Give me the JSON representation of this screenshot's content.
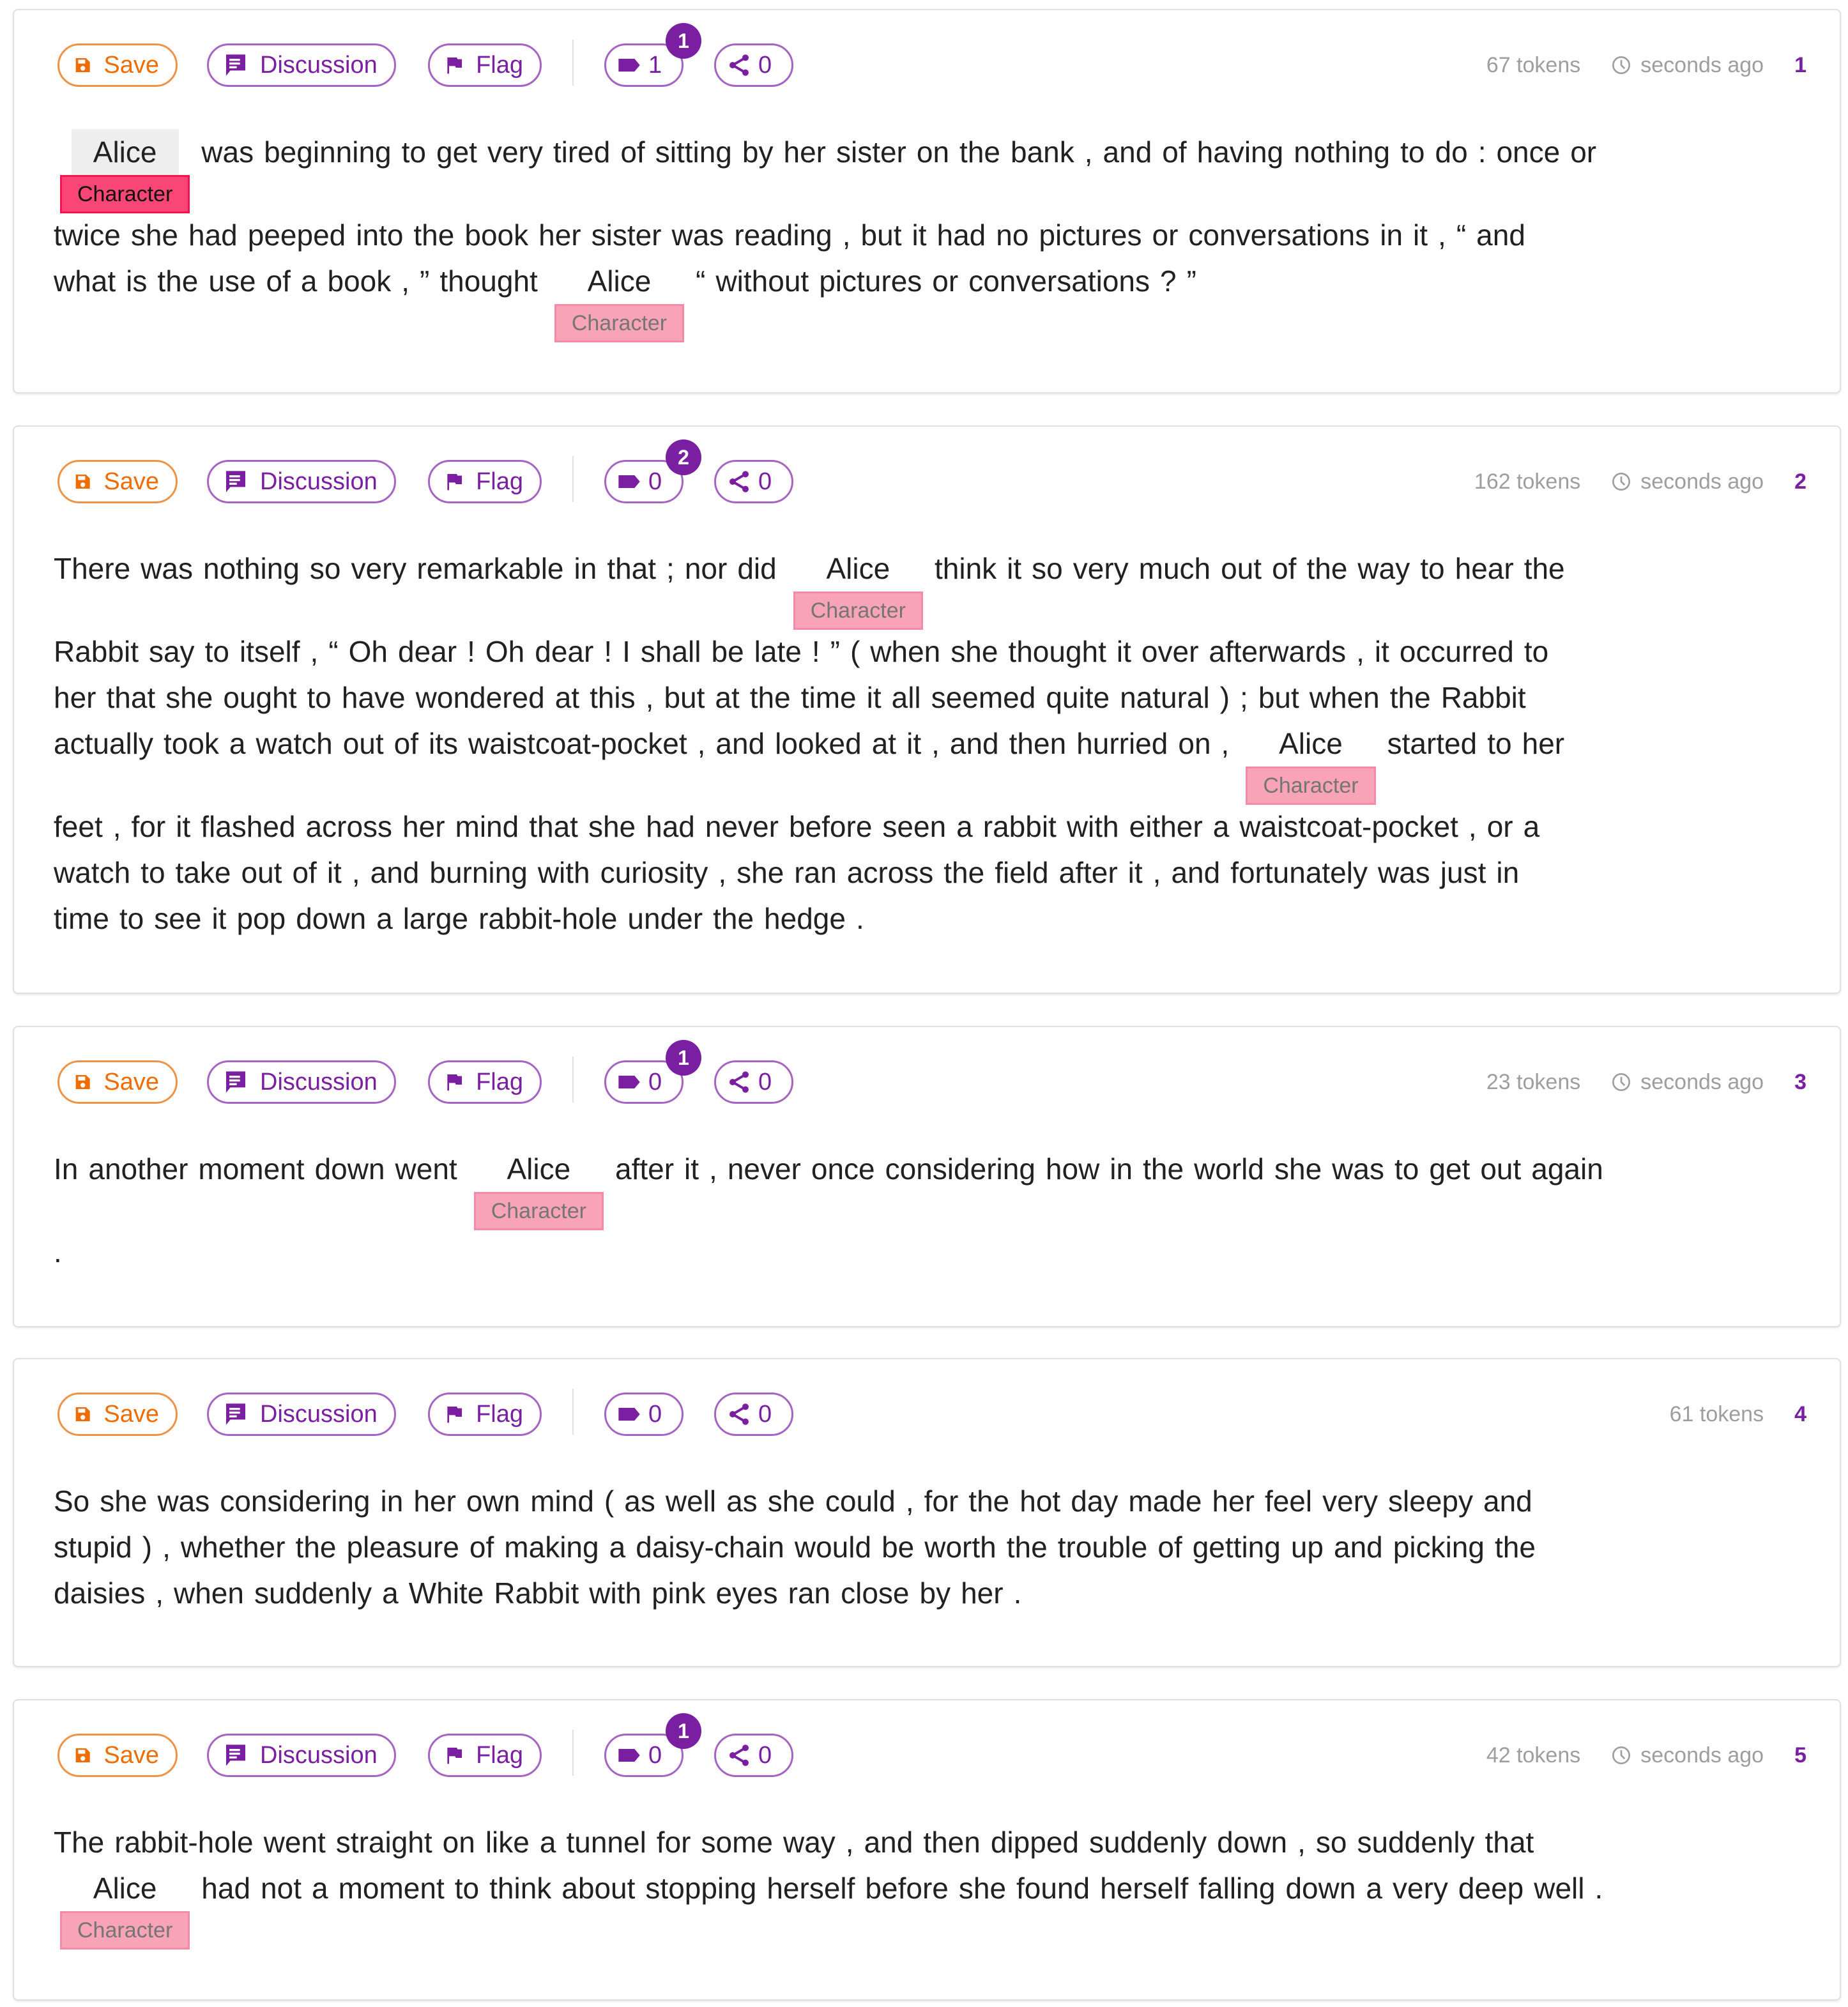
{
  "colors": {
    "accent": "#7b1fa2",
    "save": "#ef6c00",
    "label_bg": "#f9a3b9",
    "label_active_bg": "#f94677",
    "muted_text": "#9e9e9e"
  },
  "toolbar_labels": {
    "save": "Save",
    "discussion": "Discussion",
    "flag": "Flag"
  },
  "icons": {
    "save": "floppy-disk-icon",
    "discussion": "chat-bubble-icon",
    "flag": "flag-icon",
    "tag": "label-tag-icon",
    "share": "share-icon",
    "time": "clock-icon"
  },
  "cards": [
    {
      "index": "1",
      "tokens": "67 tokens",
      "time": "seconds ago",
      "tag_count": "1",
      "share_count": "0",
      "badge": "1",
      "lines": [
        [
          {
            "e": "Alice",
            "label": "Character",
            "active": true
          },
          "was",
          "beginning",
          "to",
          "get",
          "very",
          "tired",
          "of",
          "sitting",
          "by",
          "her",
          "sister",
          "on",
          "the",
          "bank",
          ",",
          "and",
          "of",
          "having",
          "nothing",
          "to",
          "do",
          ":",
          "once",
          "or"
        ],
        [
          "twice",
          "she",
          "had",
          "peeped",
          "into",
          "the",
          "book",
          "her",
          "sister",
          "was",
          "reading",
          ",",
          "but",
          "it",
          "had",
          "no",
          "pictures",
          "or",
          "conversations",
          "in",
          "it",
          ",",
          "“",
          "and"
        ],
        [
          "what",
          "is",
          "the",
          "use",
          "of",
          "a",
          "book",
          ",",
          "”",
          "thought",
          {
            "e": "Alice",
            "label": "Character"
          },
          "“",
          "without",
          "pictures",
          "or",
          "conversations",
          "?",
          "”"
        ]
      ]
    },
    {
      "index": "2",
      "tokens": "162 tokens",
      "time": "seconds ago",
      "tag_count": "0",
      "share_count": "0",
      "badge": "2",
      "lines": [
        [
          "There",
          "was",
          "nothing",
          "so",
          "very",
          "remarkable",
          "in",
          "that",
          ";",
          "nor",
          "did",
          {
            "e": "Alice",
            "label": "Character"
          },
          "think",
          "it",
          "so",
          "very",
          "much",
          "out",
          "of",
          "the",
          "way",
          "to",
          "hear",
          "the"
        ],
        [
          "Rabbit",
          "say",
          "to",
          "itself",
          ",",
          "“",
          "Oh",
          "dear",
          "!",
          "Oh",
          "dear",
          "!",
          "I",
          "shall",
          "be",
          "late",
          "!",
          "”",
          "(",
          "when",
          "she",
          "thought",
          "it",
          "over",
          "afterwards",
          ",",
          "it",
          "occurred",
          "to"
        ],
        [
          "her",
          "that",
          "she",
          "ought",
          "to",
          "have",
          "wondered",
          "at",
          "this",
          ",",
          "but",
          "at",
          "the",
          "time",
          "it",
          "all",
          "seemed",
          "quite",
          "natural",
          ")",
          ";",
          "but",
          "when",
          "the",
          "Rabbit"
        ],
        [
          "actually",
          "took",
          "a",
          "watch",
          "out",
          "of",
          "its",
          "waistcoat-pocket",
          ",",
          "and",
          "looked",
          "at",
          "it",
          ",",
          "and",
          "then",
          "hurried",
          "on",
          ",",
          {
            "e": "Alice",
            "label": "Character"
          },
          "started",
          "to",
          "her"
        ],
        [
          "feet",
          ",",
          "for",
          "it",
          "flashed",
          "across",
          "her",
          "mind",
          "that",
          "she",
          "had",
          "never",
          "before",
          "seen",
          "a",
          "rabbit",
          "with",
          "either",
          "a",
          "waistcoat-pocket",
          ",",
          "or",
          "a"
        ],
        [
          "watch",
          "to",
          "take",
          "out",
          "of",
          "it",
          ",",
          "and",
          "burning",
          "with",
          "curiosity",
          ",",
          "she",
          "ran",
          "across",
          "the",
          "field",
          "after",
          "it",
          ",",
          "and",
          "fortunately",
          "was",
          "just",
          "in"
        ],
        [
          "time",
          "to",
          "see",
          "it",
          "pop",
          "down",
          "a",
          "large",
          "rabbit-hole",
          "under",
          "the",
          "hedge",
          "."
        ]
      ]
    },
    {
      "index": "3",
      "tokens": "23 tokens",
      "time": "seconds ago",
      "tag_count": "0",
      "share_count": "0",
      "badge": "1",
      "lines": [
        [
          "In",
          "another",
          "moment",
          "down",
          "went",
          {
            "e": "Alice",
            "label": "Character"
          },
          "after",
          "it",
          ",",
          "never",
          "once",
          "considering",
          "how",
          "in",
          "the",
          "world",
          "she",
          "was",
          "to",
          "get",
          "out",
          "again"
        ],
        [
          "."
        ]
      ]
    },
    {
      "index": "4",
      "tokens": "61 tokens",
      "time": "",
      "tag_count": "0",
      "share_count": "0",
      "badge": "",
      "lines": [
        [
          "So",
          "she",
          "was",
          "considering",
          "in",
          "her",
          "own",
          "mind",
          "(",
          "as",
          "well",
          "as",
          "she",
          "could",
          ",",
          "for",
          "the",
          "hot",
          "day",
          "made",
          "her",
          "feel",
          "very",
          "sleepy",
          "and"
        ],
        [
          "stupid",
          ")",
          ",",
          "whether",
          "the",
          "pleasure",
          "of",
          "making",
          "a",
          "daisy-chain",
          "would",
          "be",
          "worth",
          "the",
          "trouble",
          "of",
          "getting",
          "up",
          "and",
          "picking",
          "the"
        ],
        [
          "daisies",
          ",",
          "when",
          "suddenly",
          "a",
          "White",
          "Rabbit",
          "with",
          "pink",
          "eyes",
          "ran",
          "close",
          "by",
          "her",
          "."
        ]
      ]
    },
    {
      "index": "5",
      "tokens": "42 tokens",
      "time": "seconds ago",
      "tag_count": "0",
      "share_count": "0",
      "badge": "1",
      "lines": [
        [
          "The",
          "rabbit-hole",
          "went",
          "straight",
          "on",
          "like",
          "a",
          "tunnel",
          "for",
          "some",
          "way",
          ",",
          "and",
          "then",
          "dipped",
          "suddenly",
          "down",
          ",",
          "so",
          "suddenly",
          "that"
        ],
        [
          {
            "e": "Alice",
            "label": "Character"
          },
          "had",
          "not",
          "a",
          "moment",
          "to",
          "think",
          "about",
          "stopping",
          "herself",
          "before",
          "she",
          "found",
          "herself",
          "falling",
          "down",
          "a",
          "very",
          "deep",
          "well",
          "."
        ]
      ]
    }
  ]
}
